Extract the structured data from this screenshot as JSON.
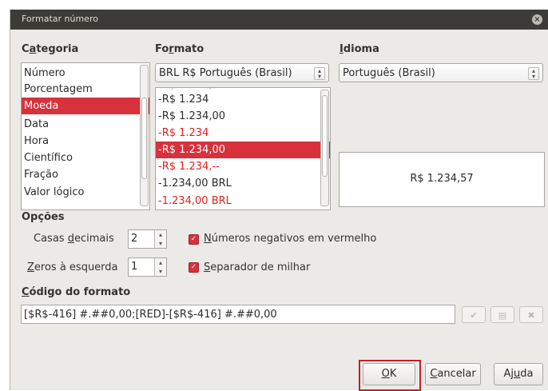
{
  "window": {
    "title": "Formatar número"
  },
  "category": {
    "header_pre": "C",
    "header_u": "a",
    "header_post": "tegoria",
    "items": [
      "Número",
      "Porcentagem",
      "Moeda",
      "Data",
      "Hora",
      "Científico",
      "Fração",
      "Valor lógico"
    ],
    "selected": "Moeda"
  },
  "format": {
    "header_pre": "Fo",
    "header_u": "r",
    "header_post": "mato",
    "combo_value": "BRL  R$  Português (Brasil)",
    "items": [
      {
        "text": "-R$ 1.234",
        "red": false
      },
      {
        "text": "-R$ 1.234,00",
        "red": false
      },
      {
        "text": "-R$ 1.234",
        "red": true
      },
      {
        "text": "-R$ 1.234,00",
        "red": false,
        "selected": true
      },
      {
        "text": "-R$ 1.234,--",
        "red": true
      },
      {
        "text": "-1.234,00 BRL",
        "red": false
      },
      {
        "text": "-1.234,00 BRL",
        "red": true
      }
    ]
  },
  "language": {
    "header_u": "I",
    "header_post": "dioma",
    "combo_value": "Português (Brasil)"
  },
  "preview": {
    "text": "R$ 1.234,57"
  },
  "options": {
    "header": "Opções",
    "decimals": {
      "label_pre": "Casas ",
      "label_u": "d",
      "label_post": "ecimais",
      "value": "2"
    },
    "leading_zeros": {
      "label_u": "Z",
      "label_post": "eros à esquerda",
      "value": "1"
    },
    "negative_red": {
      "label_u": "N",
      "label_post": "úmeros negativos em vermelho",
      "checked": true
    },
    "thousands": {
      "label_u": "S",
      "label_post": "eparador de milhar",
      "checked": true
    }
  },
  "format_code": {
    "label_u": "C",
    "label_post": "ódigo do formato",
    "value": "[$R$-416] #.##0,00;[RED]-[$R$-416] #.##0,00"
  },
  "buttons": {
    "ok_u": "O",
    "ok_post": "K",
    "cancel_u": "C",
    "cancel_post": "ancelar",
    "help_pre": "Aj",
    "help_u": "u",
    "help_post": "da"
  },
  "colors": {
    "accent": "#d7313c",
    "negative": "#e0211d",
    "titlebar": "#3c3b37",
    "dialog_bg": "#eceae7"
  }
}
